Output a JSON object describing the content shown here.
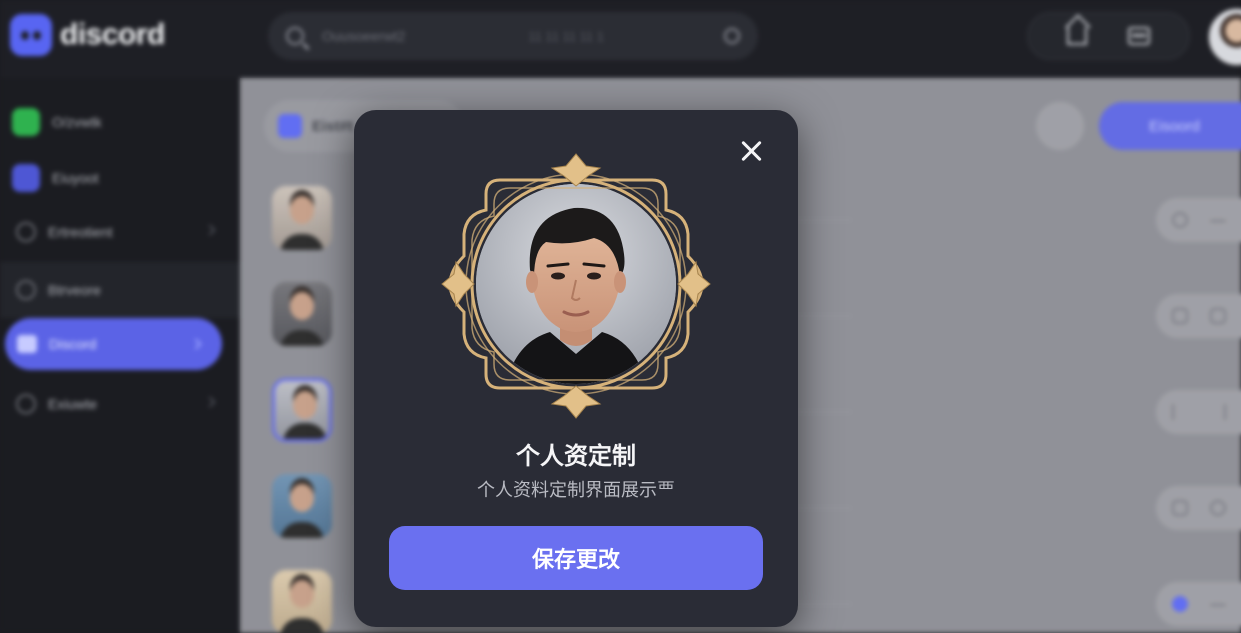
{
  "app": {
    "logo_text": "discord"
  },
  "topbar": {
    "search": {
      "placeholder": "Ouusoeerwt2",
      "middle_text": "11 11 11 11 1"
    },
    "icons": [
      "home-icon",
      "list-icon"
    ]
  },
  "sidebar": {
    "items": [
      {
        "label": "O/zvwtk",
        "icon": "green-app-icon",
        "color": "#2fb24f"
      },
      {
        "label": "Eiuyoot",
        "icon": "purple-app-icon",
        "color": "#5865f2"
      },
      {
        "label": "Ertreotient",
        "icon": "star-icon"
      },
      {
        "label": "Btrveore",
        "icon": "headset-icon"
      },
      {
        "label": "Discord",
        "icon": "discord-icon",
        "active": true
      },
      {
        "label": "Exiuwte",
        "icon": "chat-icon"
      }
    ]
  },
  "content": {
    "chip_label": "Eist#t",
    "primary_button": "Eisoord",
    "row_count_hint": ""
  },
  "modal": {
    "title": "个人资定制",
    "subtitle": "个人资料定制界面展示覀",
    "save_button": "保存更改"
  },
  "colors": {
    "accent": "#6a70f0",
    "modal_bg": "#2a2c36",
    "frame_gold": "#d6b27a"
  }
}
